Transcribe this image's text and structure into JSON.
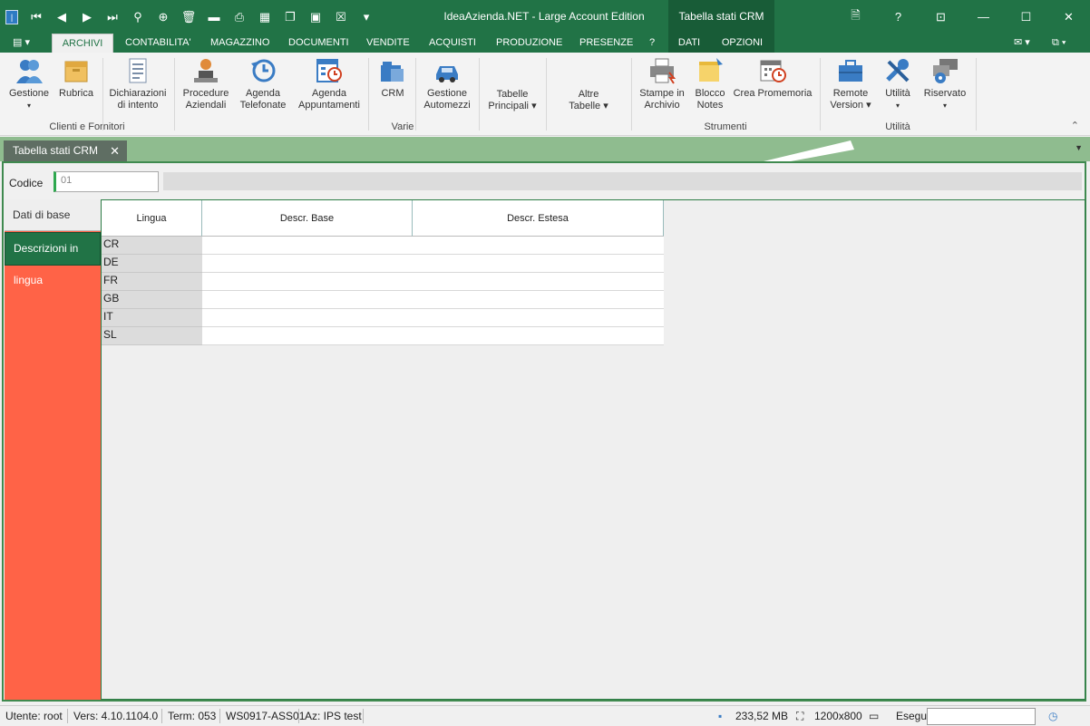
{
  "titlebar": {
    "app_title": "IdeaAzienda.NET - Large Account Edition",
    "context_title": "Tabella stati CRM",
    "help": "?",
    "win_min": "—",
    "win_max": "☐",
    "win_close": "✕",
    "qat_icons": [
      "logo-icon",
      "first-icon",
      "prev-icon",
      "next-icon",
      "last-icon",
      "search-icon",
      "new-icon",
      "delete-icon",
      "folder-icon",
      "print-icon",
      "copy-icon",
      "paste-icon",
      "preview-icon",
      "close-doc-icon",
      "customize-icon"
    ]
  },
  "tabs": [
    "ARCHIVI",
    "CONTABILITA'",
    "MAGAZZINO",
    "DOCUMENTI",
    "VENDITE",
    "ACQUISTI",
    "PRODUZIONE",
    "PRESENZE",
    "?",
    "DATI",
    "OPZIONI"
  ],
  "ribbon": {
    "clienti": {
      "gestione": "Gestione",
      "rubrica": "Rubrica",
      "dichiarazioni_1": "Dichiarazioni",
      "dichiarazioni_2": "di intento",
      "group": "Clienti e Fornitori"
    },
    "varie": {
      "procedure_1": "Procedure",
      "procedure_2": "Aziendali",
      "agenda_tel_1": "Agenda",
      "agenda_tel_2": "Telefonate",
      "agenda_app_1": "Agenda",
      "agenda_app_2": "Appuntamenti",
      "crm": "CRM",
      "gestione_auto_1": "Gestione",
      "gestione_auto_2": "Automezzi",
      "tabelle_1": "Tabelle",
      "tabelle_2": "Principali",
      "altre_1": "Altre",
      "altre_2": "Tabelle",
      "group": "Varie"
    },
    "strumenti": {
      "stampe_1": "Stampe in",
      "stampe_2": "Archivio",
      "blocco_1": "Blocco",
      "blocco_2": "Notes",
      "promemoria": "Crea Promemoria",
      "group": "Strumenti"
    },
    "utilita": {
      "remote_1": "Remote",
      "remote_2": "Version",
      "utilita": "Utilità",
      "riservato": "Riservato",
      "group": "Utilità"
    }
  },
  "doc_tab": {
    "label": "Tabella stati CRM",
    "close": "✕"
  },
  "form": {
    "codice_label": "Codice",
    "codice_value": "01"
  },
  "sidebar": {
    "items": [
      "Dati di base",
      "Descrizioni in lingua"
    ]
  },
  "grid": {
    "columns": [
      "Lingua",
      "Descr. Base",
      "Descr. Estesa"
    ],
    "rows": [
      {
        "lingua": "CR",
        "base": "",
        "estesa": ""
      },
      {
        "lingua": "DE",
        "base": "",
        "estesa": ""
      },
      {
        "lingua": "FR",
        "base": "",
        "estesa": ""
      },
      {
        "lingua": "GB",
        "base": "",
        "estesa": ""
      },
      {
        "lingua": "IT",
        "base": "",
        "estesa": ""
      },
      {
        "lingua": "SL",
        "base": "",
        "estesa": ""
      }
    ]
  },
  "status": {
    "utente": "Utente: root",
    "vers": "Vers: 4.10.1104.0",
    "term": "Term: 053",
    "ws": "WS0917-ASS01",
    "az": "Az: IPS test",
    "memory": "233,52 MB",
    "resolution": "1200x800",
    "esegui": "Esegui"
  },
  "colors": {
    "brand_green": "#217346",
    "context_green": "#185c37",
    "sidebar_red": "#ff6347",
    "doctab_bg": "#8fbc8f"
  }
}
